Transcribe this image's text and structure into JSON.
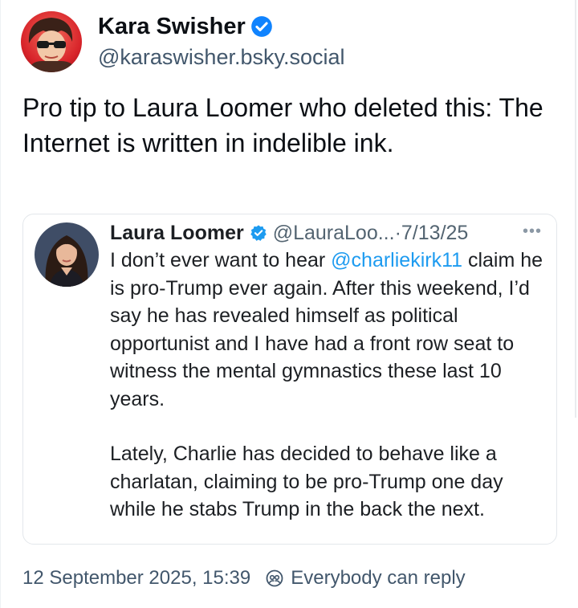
{
  "author": {
    "name": "Kara Swisher",
    "handle": "@karaswisher.bsky.social",
    "verified": true
  },
  "post": {
    "text": "Pro tip to Laura Loomer who deleted this: The Internet is written in indelible ink."
  },
  "quoted": {
    "name": "Laura Loomer",
    "handle": "@LauraLoo...",
    "dot": "·",
    "date": "7/13/25",
    "more_icon": "more-horizontal-icon",
    "para1_prefix": "I don’t ever want to hear ",
    "mention": "@charliekirk11",
    "para1_suffix": " claim he is pro-Trump ever again. After this weekend, I’d say he has revealed himself as political opportunist and I have had a front row seat to witness the mental gymnastics these last 10 years.",
    "para2": "Lately, Charlie has decided to behave like a charlatan, claiming to be pro-Trump one day while he stabs Trump in the back the next."
  },
  "footer": {
    "timestamp": "12 September 2025, 15:39",
    "reply_setting": "Everybody can reply"
  },
  "colors": {
    "verified_blue": "#1083fe",
    "twitter_verified_blue": "#1d9bf0",
    "mention_blue": "#1d9bf0",
    "secondary_text": "#42576c"
  }
}
